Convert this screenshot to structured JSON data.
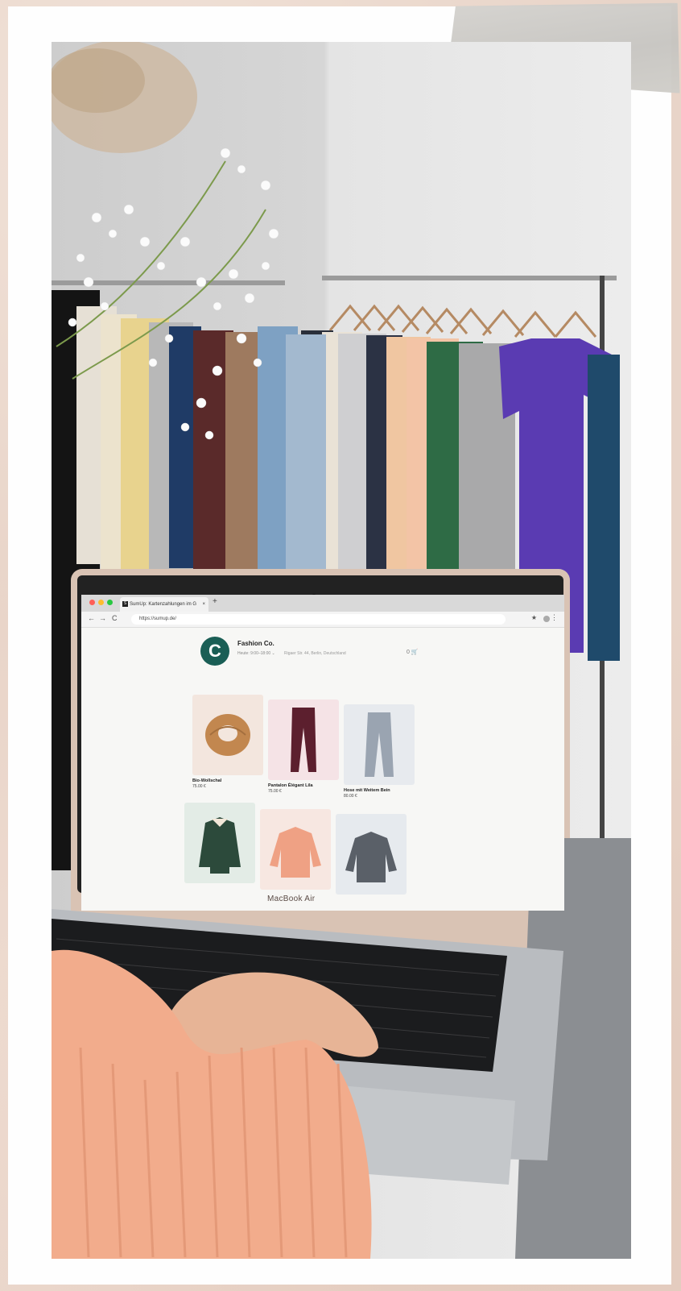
{
  "browser": {
    "tab_title": "SumUp: Kartenzahlungen im G",
    "tab_close": "×",
    "new_tab": "+",
    "url": "https://sumup.de/",
    "nav_back": "←",
    "nav_forward": "→",
    "nav_reload": "C",
    "bookmark_icon": "★",
    "menu_icon": "⋮"
  },
  "shop": {
    "logo_letter": "C",
    "name": "Fashion Co.",
    "meta": "Heute: 9:00–18:00  ⌄",
    "address": "Rigaer Str. 44, Berlin, Deutschland",
    "cart": "0 🛒"
  },
  "products": [
    {
      "name": "Bio-Wollschal",
      "price": "75.00 €",
      "bg": "#f3e6de",
      "item": "scarf"
    },
    {
      "name": "Pantalon Élégant Lila",
      "price": "75.00 €",
      "bg": "#f5e3e6",
      "item": "pants-maroon"
    },
    {
      "name": "Hose mit Weitem Bein",
      "price": "80.00 €",
      "bg": "#e7eaee",
      "item": "pants-grey"
    },
    {
      "name": "",
      "price": "",
      "bg": "#e3ece6",
      "item": "jacket"
    },
    {
      "name": "",
      "price": "",
      "bg": "#f7e7e1",
      "item": "sweater-pink"
    },
    {
      "name": "",
      "price": "",
      "bg": "#e6eaee",
      "item": "sweater-grey"
    }
  ],
  "laptop_label": "MacBook Air",
  "colors": {
    "brand": "#1a5e55",
    "rack_shirt_purple": "#5a3bb2",
    "rack_shirt_green": "#2e6b45",
    "sweater_peach": "#efa184"
  }
}
